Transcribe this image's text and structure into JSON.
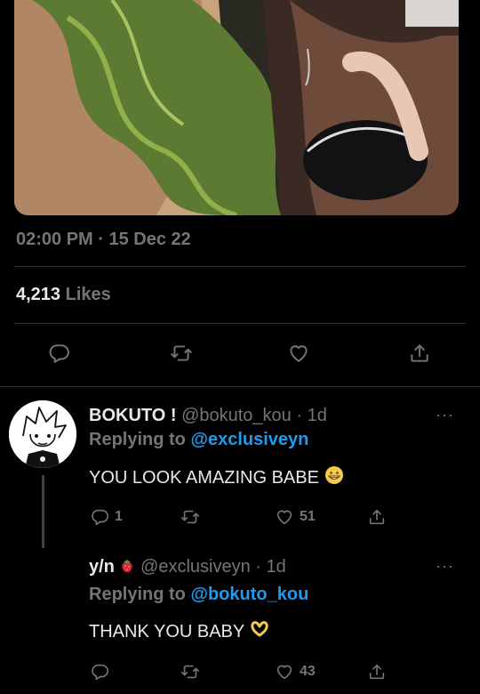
{
  "tweet": {
    "timestamp": "02:00 PM · 15 Dec 22",
    "likes_count": "4,213",
    "likes_label": "Likes"
  },
  "replies": [
    {
      "display_name": "BOKUTO !",
      "handle_time": "@bokuto_kou · 1d",
      "replying_prefix": "Replying to",
      "replying_to": "@exclusiveyn",
      "text": "YOU LOOK AMAZING BABE",
      "emoji": "grinning-face",
      "reply_count": "1",
      "like_count": "51"
    },
    {
      "display_name": "y/n",
      "handle_time": "@exclusiveyn · 1d",
      "replying_prefix": "Replying to",
      "replying_to": "@bokuto_kou",
      "text": "THANK YOU BABY",
      "emoji": "heart-hands",
      "reply_count": "",
      "like_count": "43"
    }
  ],
  "more_label": "···",
  "colors": {
    "background": "#000000",
    "text": "#e7e9ea",
    "muted": "#71767b",
    "link": "#1d9bf0",
    "divider": "#2f3336"
  }
}
